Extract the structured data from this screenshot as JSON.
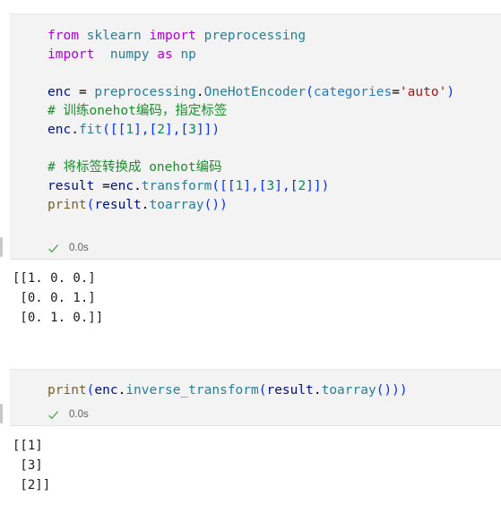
{
  "app": {
    "type": "jupyter-notebook",
    "background": "#ffffff",
    "cell_background": "#f3f3f3"
  },
  "colors": {
    "keyword": "#af00db",
    "module": "#267f99",
    "variable": "#001080",
    "function": "#795e26",
    "bracket": "#0431fa",
    "number": "#09885a",
    "string": "#a31515",
    "argument": "#2a7bc0",
    "comment": "#1d8c2e",
    "success": "#3f9b3f",
    "elapsed_text": "#616161"
  },
  "cells": [
    {
      "index": 0,
      "code_lines": [
        "from sklearn import preprocessing",
        "import  numpy as np",
        "",
        "enc = preprocessing.OneHotEncoder(categories='auto')",
        "# 训练onehot编码，指定标签",
        "enc.fit([[1],[2],[3]])",
        "",
        "# 将标签转换成 onehot编码",
        "result =enc.transform([[1],[3],[2]])",
        "print(result.toarray())"
      ],
      "status": {
        "icon": "check-icon",
        "elapsed": "0.0s"
      },
      "output_lines": [
        "[[1. 0. 0.]",
        " [0. 0. 1.]",
        " [0. 1. 0.]]"
      ]
    },
    {
      "index": 1,
      "code_lines": [
        "print(enc.inverse_transform(result.toarray()))"
      ],
      "status": {
        "icon": "check-icon",
        "elapsed": "0.0s"
      },
      "output_lines": [
        "[[1]",
        " [3]",
        " [2]]"
      ]
    }
  ]
}
